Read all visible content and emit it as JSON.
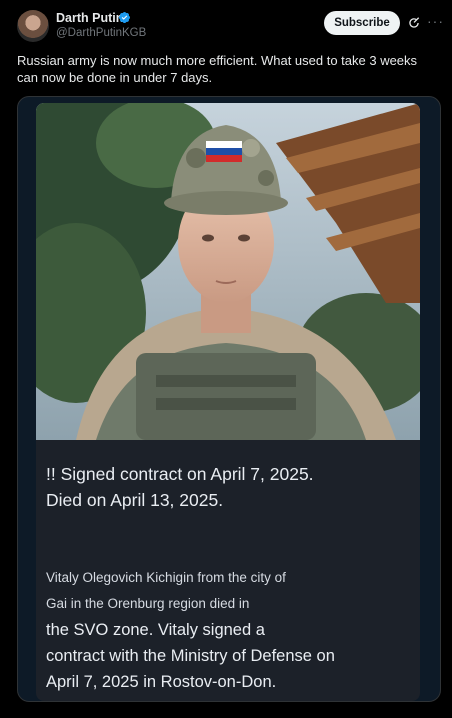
{
  "author": {
    "display_name": "Darth Putin",
    "handle": "@DarthPutinKGB",
    "verified": true
  },
  "actions": {
    "subscribe_label": "Subscribe",
    "grok_icon": "grok-icon",
    "more_icon": "more-icon"
  },
  "tweet": {
    "text": "Russian army is now much more efficient. What used to take 3 weeks can now be done in under 7 days."
  },
  "image_card": {
    "headline_line1": "!! Signed contract on April 7, 2025.",
    "headline_line2": "Died on April 13, 2025.",
    "body_small_line1": "Vitaly Olegovich Kichigin from the city of",
    "body_small_line2": "Gai in the Orenburg region died in",
    "body_large_line1": "the SVO zone. Vitaly signed a",
    "body_large_line2": "contract with the Ministry of Defense on",
    "body_large_line3": "April 7, 2025 in Rostov-on-Don."
  },
  "colors": {
    "background": "#000000",
    "text_primary": "#e7e9ea",
    "text_secondary": "#71767b",
    "verified_blue": "#1d9bf0",
    "button_bg": "#eff3f4",
    "card_bg": "#1c2129"
  }
}
